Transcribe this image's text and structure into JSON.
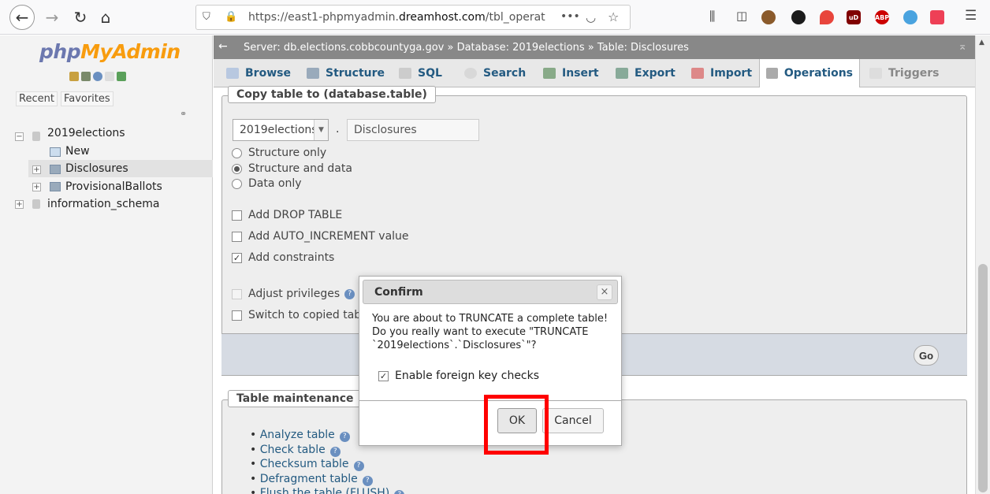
{
  "browser": {
    "url_prefix": "https://east1-phpmyadmin.",
    "url_domain": "dreamhost.com",
    "url_suffix": "/tbl_operat",
    "more": "•••"
  },
  "sidebar": {
    "logo_php": "php",
    "logo_myadmin": "MyAdmin",
    "tab_recent": "Recent",
    "tab_favorites": "Favorites",
    "tree": {
      "db1": "2019elections",
      "new": "New",
      "tbl1": "Disclosures",
      "tbl2": "ProvisionalBallots",
      "db2": "information_schema"
    }
  },
  "breadcrumb": {
    "server": "Server: db.elections.cobbcountyga.gov »",
    "database": "Database: 2019elections »",
    "table": "Table: Disclosures"
  },
  "tabs": {
    "browse": "Browse",
    "structure": "Structure",
    "sql": "SQL",
    "search": "Search",
    "insert": "Insert",
    "export": "Export",
    "import": "Import",
    "operations": "Operations",
    "triggers": "Triggers"
  },
  "copy": {
    "legend": "Copy table to (database.table)",
    "db_select": "2019elections",
    "dot": ".",
    "table_name": "Disclosures",
    "opt_structure_only": "Structure only",
    "opt_structure_data": "Structure and data",
    "opt_data_only": "Data only",
    "add_drop": "Add DROP TABLE",
    "add_auto": "Add AUTO_INCREMENT value",
    "add_constraints": "Add constraints",
    "adjust_priv": "Adjust privileges",
    "switch_copied": "Switch to copied table",
    "go": "Go"
  },
  "maintenance": {
    "legend": "Table maintenance",
    "items": [
      "Analyze table",
      "Check table",
      "Checksum table",
      "Defragment table",
      "Flush the table (FLUSH)"
    ]
  },
  "dialog": {
    "title": "Confirm",
    "close": "×",
    "message": "You are about to TRUNCATE a complete table! Do you really want to execute \"TRUNCATE `2019elections`.`Disclosures`\"?",
    "fk_label": "Enable foreign key checks",
    "ok": "OK",
    "cancel": "Cancel"
  },
  "colors": {
    "accent": "#235a81",
    "highlight": "#ff0000",
    "logo_orange": "#f89c0e",
    "logo_blue": "#6c78af"
  }
}
